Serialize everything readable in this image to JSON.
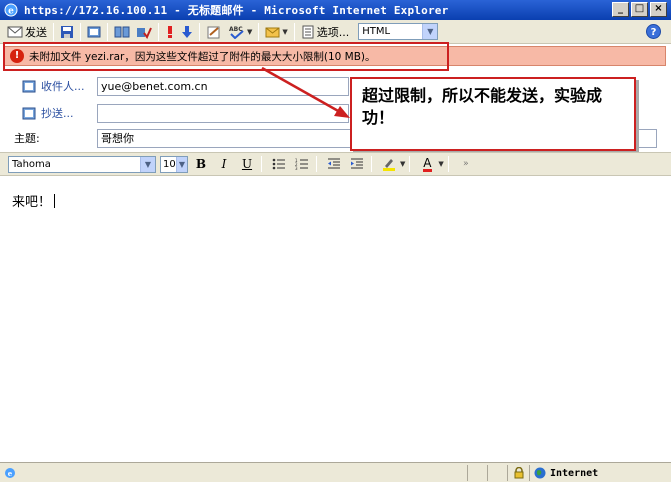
{
  "window": {
    "title": "https://172.16.100.11 - 无标题邮件 - Microsoft Internet Explorer",
    "min_label": "_",
    "max_label": "□",
    "close_label": "×"
  },
  "toolbar": {
    "send_label": "发送",
    "options_label": "选项...",
    "format_value": "HTML",
    "help_label": "?"
  },
  "alert": {
    "icon_label": "!",
    "message": "未附加文件 yezi.rar，因为这些文件超过了附件的最大大小限制(10 MB)。"
  },
  "fields": {
    "to_label": "收件人...",
    "to_value": "yue@benet.com.cn",
    "cc_label": "抄送...",
    "cc_value": "",
    "subject_label": "主题:",
    "subject_value": "哥想你"
  },
  "callout": {
    "text": "超过限制，所以不能发送，实验成功！"
  },
  "format_bar": {
    "font_value": "Tahoma",
    "size_value": "10",
    "bold_label": "B",
    "italic_label": "I",
    "underline_label": "U",
    "text_color_label": "A"
  },
  "body": {
    "text": "来吧！"
  },
  "status": {
    "zone_label": "Internet"
  },
  "colors": {
    "titlebar": "#0a3fb0",
    "alert_bg": "#f7b9a6",
    "highlight_border": "#cc2020"
  },
  "icons": [
    "ie-icon",
    "send-icon",
    "save-icon",
    "attach-icon",
    "address-book-icon",
    "check-names-icon",
    "high-priority-icon",
    "low-priority-icon",
    "signature-icon",
    "spell-check-icon",
    "flag-icon",
    "options-icon",
    "help-icon",
    "alert-icon",
    "bullet-list-icon",
    "numbered-list-icon",
    "outdent-icon",
    "indent-icon",
    "highlight-icon",
    "font-color-icon",
    "more-icon",
    "lock-icon",
    "globe-icon"
  ]
}
